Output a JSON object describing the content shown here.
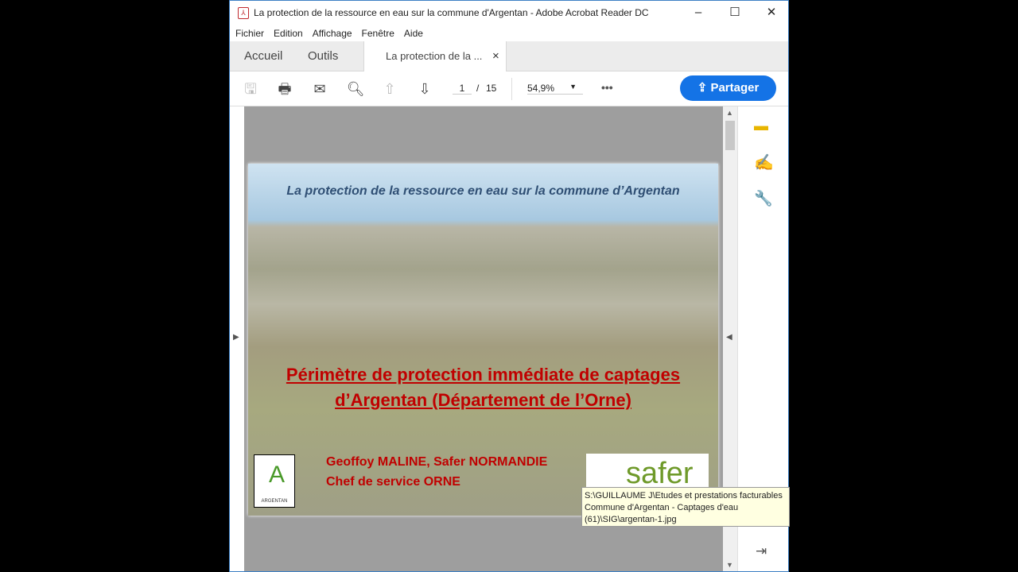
{
  "window": {
    "title": "La protection de la ressource en eau sur la commune d'Argentan - Adobe Acrobat Reader DC",
    "minimize": "–",
    "maximize": "☐",
    "close": "✕"
  },
  "menu": [
    "Fichier",
    "Edition",
    "Affichage",
    "Fenêtre",
    "Aide"
  ],
  "tabs": {
    "home": "Accueil",
    "tools": "Outils",
    "doc": "La protection de la ...",
    "doc_close": "×"
  },
  "toolbar": {
    "page_current": "1",
    "page_sep": "/",
    "page_total": "15",
    "zoom": "54,9%",
    "more": "•••",
    "share": "Partager"
  },
  "page": {
    "title": "La protection de la ressource en eau sur la commune d’Argentan",
    "heading1": "Périmètre de protection immédiate de captages",
    "heading2": "d’Argentan (Département de l’Orne)",
    "author": "Geoffoy MALINE, Safer NORMANDIE",
    "role": "Chef de service ORNE",
    "logo_left": "ARGENTAN",
    "logo_right": "safer"
  },
  "tooltip": {
    "line1": "S:\\GUILLAUME J\\Etudes et prestations facturables",
    "line2": "Commune d'Argentan - Captages d'eau",
    "line3": "(61)\\SIG\\argentan-1.jpg"
  }
}
